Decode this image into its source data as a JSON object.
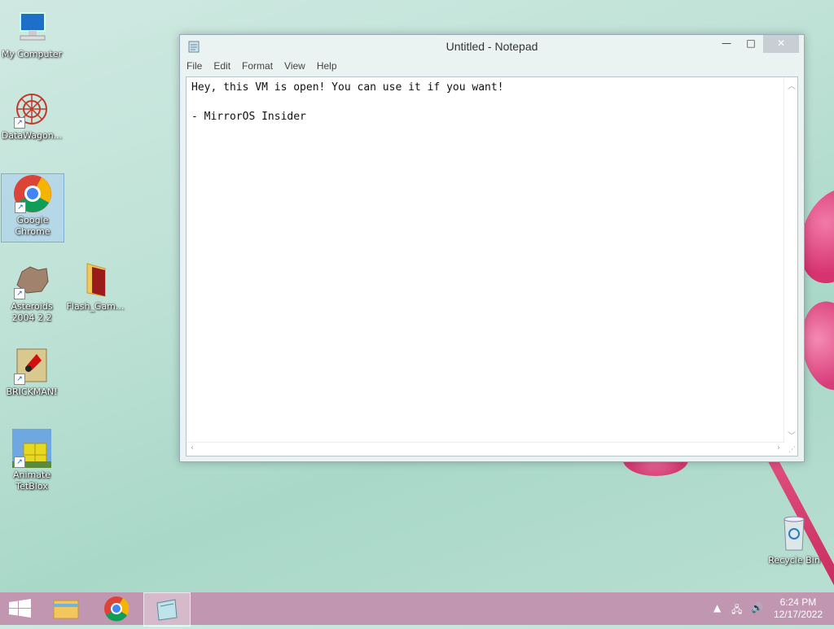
{
  "desktop": {
    "icons": [
      {
        "label": "My Computer"
      },
      {
        "label": "DataWagon..."
      },
      {
        "label": "Google Chrome"
      },
      {
        "label": "Asteroids 2004 2.2"
      },
      {
        "label": "Flash_Gam..."
      },
      {
        "label": "BRICKMAN!"
      },
      {
        "label": "Animate TetBlox"
      },
      {
        "label": "Recycle Bin"
      }
    ]
  },
  "notepad": {
    "title": "Untitled - Notepad",
    "menu": [
      "File",
      "Edit",
      "Format",
      "View",
      "Help"
    ],
    "lines": [
      "Hey, this VM is open! You can use it if you want!",
      "",
      "- MirrorOS Insider"
    ],
    "controls": {
      "minimize": "—",
      "maximize": "□",
      "close": "✕"
    }
  },
  "taskbar": {
    "time": "6:24 PM",
    "date": "12/17/2022"
  },
  "colors": {
    "taskbar": "#c196b1",
    "accent_pink": "#d6336f"
  }
}
